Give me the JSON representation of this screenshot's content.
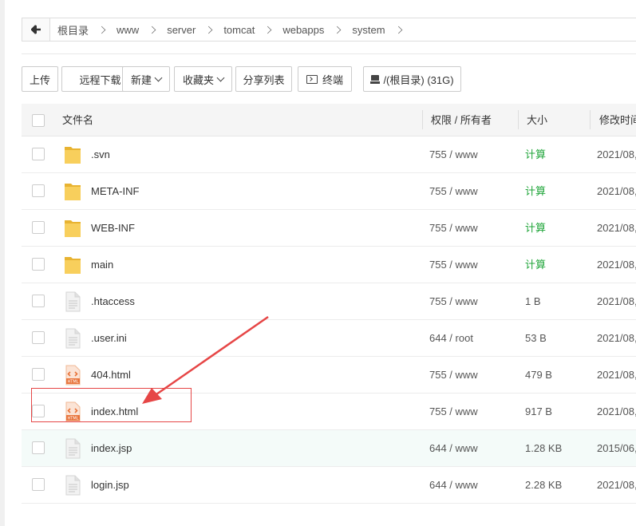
{
  "breadcrumb": {
    "items": [
      "根目录",
      "www",
      "server",
      "tomcat",
      "webapps",
      "system"
    ]
  },
  "toolbar": {
    "upload": "上传",
    "remote_download": "远程下载",
    "new": "新建",
    "favorites": "收藏夹",
    "share_list": "分享列表",
    "terminal": "终端",
    "disk": "/(根目录) (31G)"
  },
  "table": {
    "headers": {
      "name": "文件名",
      "perm": "权限 / 所有者",
      "size": "大小",
      "mtime": "修改时间"
    },
    "rows": [
      {
        "name": ".svn",
        "type": "folder",
        "perm": "755 / www",
        "size": "计算",
        "mtime": "2021/08,"
      },
      {
        "name": "META-INF",
        "type": "folder",
        "perm": "755 / www",
        "size": "计算",
        "mtime": "2021/08,"
      },
      {
        "name": "WEB-INF",
        "type": "folder",
        "perm": "755 / www",
        "size": "计算",
        "mtime": "2021/08,"
      },
      {
        "name": "main",
        "type": "folder",
        "perm": "755 / www",
        "size": "计算",
        "mtime": "2021/08,"
      },
      {
        "name": ".htaccess",
        "type": "file",
        "perm": "755 / www",
        "size": "1 B",
        "mtime": "2021/08,"
      },
      {
        "name": ".user.ini",
        "type": "file",
        "perm": "644 / root",
        "size": "53 B",
        "mtime": "2021/08,"
      },
      {
        "name": "404.html",
        "type": "html",
        "perm": "755 / www",
        "size": "479 B",
        "mtime": "2021/08,"
      },
      {
        "name": "index.html",
        "type": "html",
        "perm": "755 / www",
        "size": "917 B",
        "mtime": "2021/08,"
      },
      {
        "name": "index.jsp",
        "type": "file",
        "perm": "644 / www",
        "size": "1.28 KB",
        "mtime": "2015/06,"
      },
      {
        "name": "login.jsp",
        "type": "file",
        "perm": "644 / www",
        "size": "2.28 KB",
        "mtime": "2021/08,"
      }
    ]
  },
  "colors": {
    "calc_green": "#20a53a",
    "annotation_red": "#e64646",
    "folder_yellow": "#f5c342",
    "html_orange": "#e8743b"
  }
}
